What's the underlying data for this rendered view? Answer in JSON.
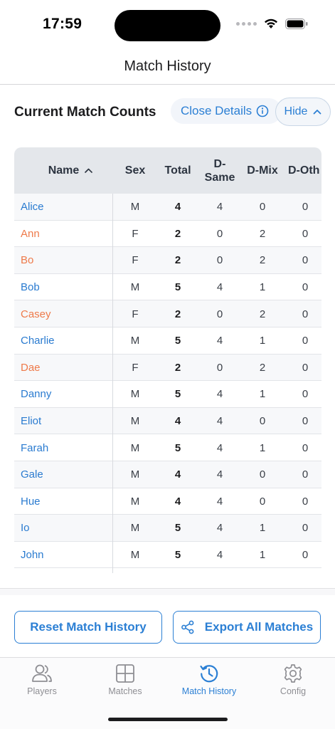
{
  "status": {
    "time": "17:59"
  },
  "nav": {
    "title": "Match History"
  },
  "section": {
    "title": "Current Match Counts",
    "close_details_label": "Close Details",
    "hide_label": "Hide"
  },
  "table": {
    "columns": {
      "name": "Name",
      "sex": "Sex",
      "total": "Total",
      "d_same_top": "D-",
      "d_same_bottom": "Same",
      "d_mix": "D-Mix",
      "d_oth": "D-Oth"
    },
    "rows": [
      {
        "name": "Alice",
        "sex": "M",
        "total": "4",
        "d_same": "4",
        "d_mix": "0",
        "d_oth": "0"
      },
      {
        "name": "Ann",
        "sex": "F",
        "total": "2",
        "d_same": "0",
        "d_mix": "2",
        "d_oth": "0"
      },
      {
        "name": "Bo",
        "sex": "F",
        "total": "2",
        "d_same": "0",
        "d_mix": "2",
        "d_oth": "0"
      },
      {
        "name": "Bob",
        "sex": "M",
        "total": "5",
        "d_same": "4",
        "d_mix": "1",
        "d_oth": "0"
      },
      {
        "name": "Casey",
        "sex": "F",
        "total": "2",
        "d_same": "0",
        "d_mix": "2",
        "d_oth": "0"
      },
      {
        "name": "Charlie",
        "sex": "M",
        "total": "5",
        "d_same": "4",
        "d_mix": "1",
        "d_oth": "0"
      },
      {
        "name": "Dae",
        "sex": "F",
        "total": "2",
        "d_same": "0",
        "d_mix": "2",
        "d_oth": "0"
      },
      {
        "name": "Danny",
        "sex": "M",
        "total": "5",
        "d_same": "4",
        "d_mix": "1",
        "d_oth": "0"
      },
      {
        "name": "Eliot",
        "sex": "M",
        "total": "4",
        "d_same": "4",
        "d_mix": "0",
        "d_oth": "0"
      },
      {
        "name": "Farah",
        "sex": "M",
        "total": "5",
        "d_same": "4",
        "d_mix": "1",
        "d_oth": "0"
      },
      {
        "name": "Gale",
        "sex": "M",
        "total": "4",
        "d_same": "4",
        "d_mix": "0",
        "d_oth": "0"
      },
      {
        "name": "Hue",
        "sex": "M",
        "total": "4",
        "d_same": "4",
        "d_mix": "0",
        "d_oth": "0"
      },
      {
        "name": "Io",
        "sex": "M",
        "total": "5",
        "d_same": "4",
        "d_mix": "1",
        "d_oth": "0"
      },
      {
        "name": "John",
        "sex": "M",
        "total": "5",
        "d_same": "4",
        "d_mix": "1",
        "d_oth": "0"
      }
    ]
  },
  "actions": {
    "reset_label": "Reset Match History",
    "export_label": "Export All Matches"
  },
  "tabs": [
    {
      "label": "Players",
      "icon": "players-icon"
    },
    {
      "label": "Matches",
      "icon": "matches-grid-icon"
    },
    {
      "label": "Match History",
      "icon": "history-icon"
    },
    {
      "label": "Config",
      "icon": "gear-icon"
    }
  ],
  "colors": {
    "accent": "#2b7fd4",
    "male_name": "#2a7bd0",
    "female_name": "#ee7a4a",
    "header_bg": "#e4e7eb"
  }
}
